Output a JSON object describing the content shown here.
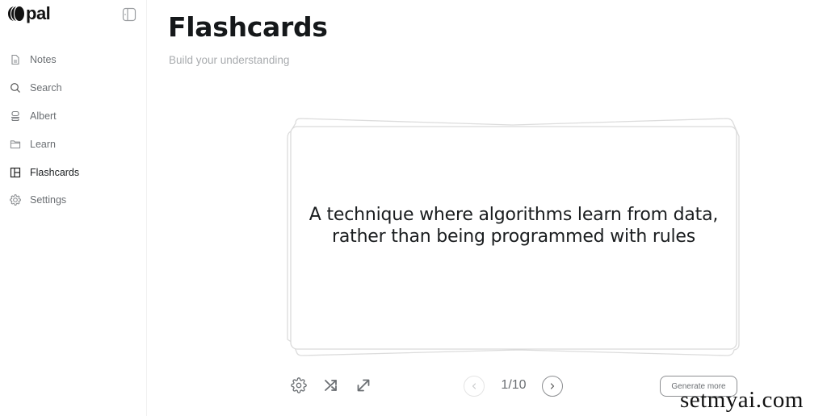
{
  "app": {
    "logo_text": "pal"
  },
  "sidebar": {
    "items": [
      {
        "label": "Notes",
        "icon": "document-icon",
        "active": false
      },
      {
        "label": "Search",
        "icon": "search-icon",
        "active": false
      },
      {
        "label": "Albert",
        "icon": "robot-icon",
        "active": false
      },
      {
        "label": "Learn",
        "icon": "folder-icon",
        "active": false
      },
      {
        "label": "Flashcards",
        "icon": "layout-icon",
        "active": true
      },
      {
        "label": "Settings",
        "icon": "gear-icon",
        "active": false
      }
    ]
  },
  "page": {
    "title": "Flashcards",
    "subtitle": "Build your understanding"
  },
  "flashcard": {
    "text": "A technique where algorithms learn from data, rather than being programmed with rules"
  },
  "controls": {
    "settings_icon": "gear-icon",
    "shuffle_icon": "shuffle-icon",
    "expand_icon": "expand-icon"
  },
  "pagination": {
    "current": 1,
    "total": 10,
    "display": "1/10"
  },
  "actions": {
    "generate_more_label": "Generate more"
  },
  "watermark": {
    "text": "setmyai.com"
  },
  "colors": {
    "text_primary": "#1a1d1f",
    "text_muted": "#6b6f73",
    "subtitle": "#a8abae",
    "card_border": "#d9d9d9"
  }
}
